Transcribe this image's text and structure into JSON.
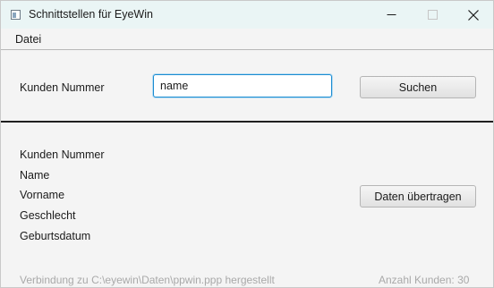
{
  "window": {
    "title": "Schnittstellen für EyeWin",
    "icon": "app-window-icon",
    "controls": [
      "minimize-icon",
      "maximize-icon",
      "close-icon"
    ]
  },
  "menubar": {
    "items": [
      "Datei"
    ]
  },
  "search": {
    "label": "Kunden Nummer",
    "input_value": "name",
    "button_label": "Suchen"
  },
  "details": {
    "fields": [
      "Kunden Nummer",
      "Name",
      "Vorname",
      "Geschlecht",
      "Geburtsdatum"
    ],
    "transfer_button": "Daten übertragen"
  },
  "status": {
    "connection": "Verbindung zu C:\\eyewin\\Daten\\ppwin.ppp hergestellt",
    "count": "Anzahl Kunden: 30"
  },
  "colors": {
    "titlebar": "#eaf5f5",
    "panel": "#f4f4f4",
    "focus": "#1b8cd1",
    "status_text": "#a9a9a9"
  }
}
